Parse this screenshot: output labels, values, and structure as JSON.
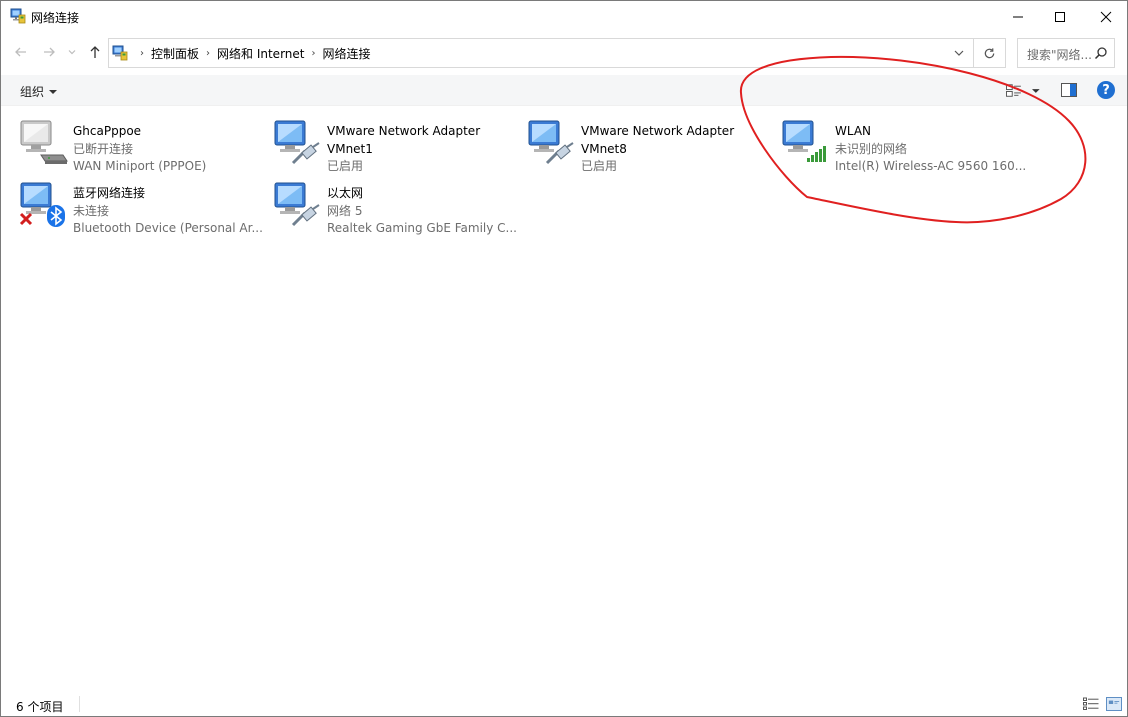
{
  "window": {
    "title": "网络连接",
    "title_icon": "network-connections-icon",
    "controls": {
      "minimize": "minimize-icon",
      "maximize": "maximize-icon",
      "close": "close-icon"
    }
  },
  "navigation": {
    "back_icon": "arrow-left-icon",
    "forward_icon": "arrow-right-icon",
    "recent_icon": "chevron-down-icon",
    "up_icon": "arrow-up-icon",
    "breadcrumbs": [
      "控制面板",
      "网络和 Internet",
      "网络连接"
    ],
    "breadcrumb_separator": "›",
    "refresh_icon": "refresh-icon",
    "search_placeholder": "搜索\"网络..."
  },
  "command_bar": {
    "organize_label": "组织",
    "view_icon": "change-view-icon",
    "preview_icon": "preview-pane-icon",
    "help_label": "?"
  },
  "connections": [
    {
      "name": "GhcaPppoe",
      "status": "已断开连接",
      "device": "WAN Miniport (PPPOE)",
      "badge": "modem-icon"
    },
    {
      "name": "VMware Network Adapter VMnet1",
      "name_line1": "VMware Network Adapter",
      "name_line2": "VMnet1",
      "status": "已启用",
      "badge": "ethernet-plug-icon"
    },
    {
      "name": "VMware Network Adapter VMnet8",
      "name_line1": "VMware Network Adapter",
      "name_line2": "VMnet8",
      "status": "已启用",
      "badge": "ethernet-plug-icon"
    },
    {
      "name": "WLAN",
      "status": "未识别的网络",
      "device": "Intel(R) Wireless-AC 9560 160...",
      "badge": "wifi-signal-icon"
    },
    {
      "name": "蓝牙网络连接",
      "status": "未连接",
      "device": "Bluetooth Device (Personal Ar...",
      "badge": "bluetooth-icon",
      "overlay": "red-x-icon"
    },
    {
      "name": "以太网",
      "status": "网络 5",
      "device": "Realtek Gaming GbE Family C...",
      "badge": "ethernet-plug-icon"
    }
  ],
  "status_bar": {
    "item_count": "6 个项目",
    "details_view_icon": "details-view-icon",
    "tiles_view_icon": "tiles-view-icon"
  },
  "annotation": {
    "shape": "hand-drawn ellipse",
    "color": "#e02020",
    "target": "WLAN"
  },
  "colors": {
    "accent": "#1f6fd1",
    "secondary_text": "#6d6d6d",
    "annotation_red": "#e02020",
    "wifi_green": "#3a9a3a"
  }
}
